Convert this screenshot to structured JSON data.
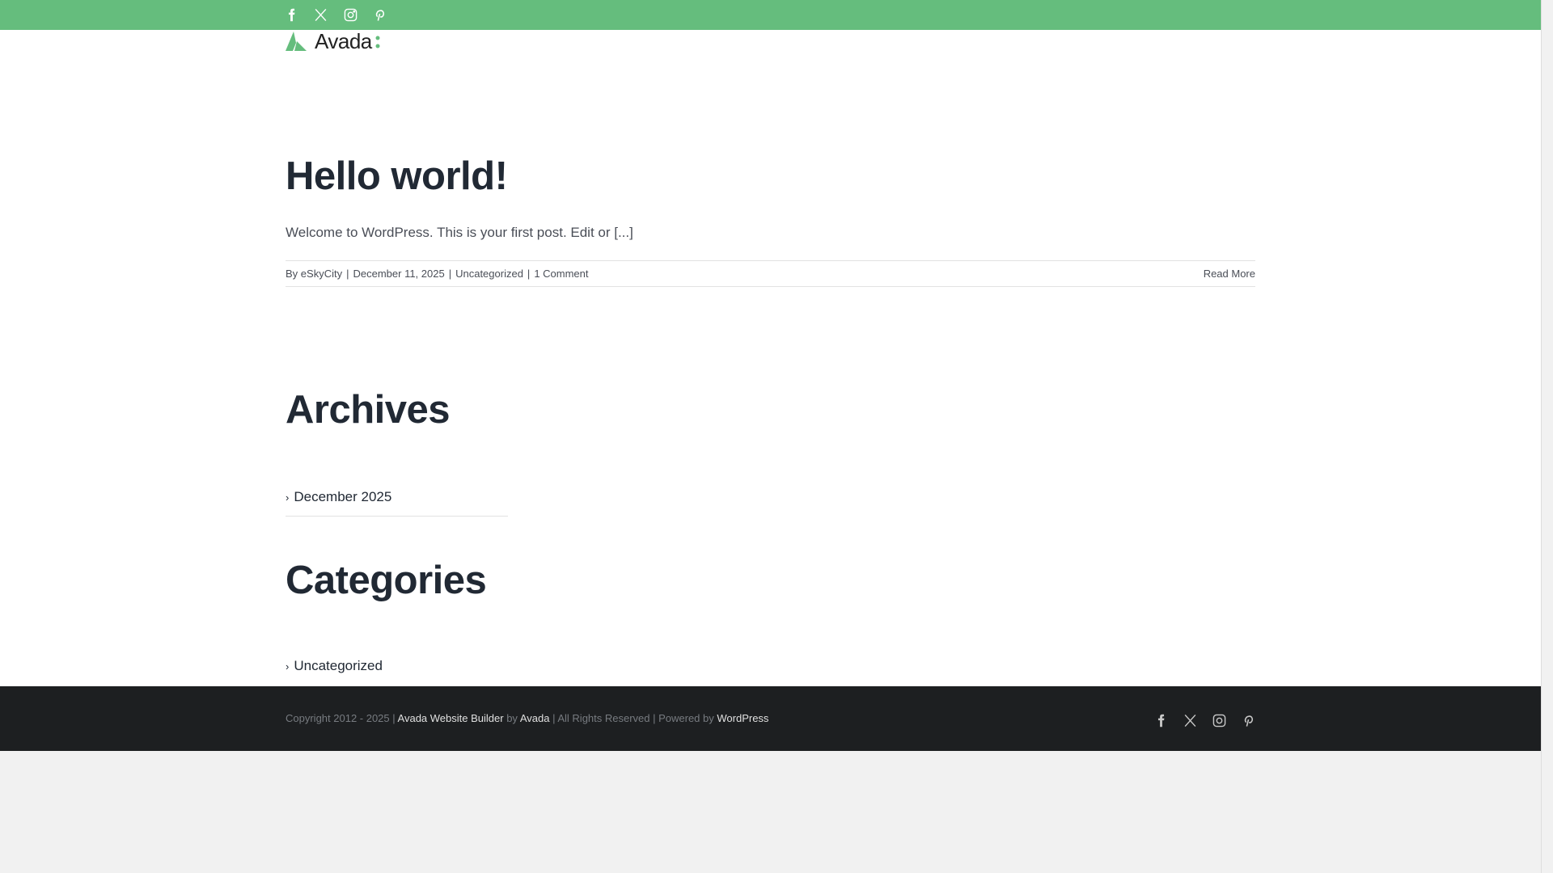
{
  "topbar": {
    "social": [
      "facebook",
      "x",
      "instagram",
      "pinterest"
    ]
  },
  "logo": {
    "text": "Avada"
  },
  "post": {
    "title": "Hello world!",
    "excerpt": "Welcome to WordPress. This is your first post. Edit or [...]",
    "by": "By",
    "author": "eSkyCity",
    "date": "December 11, 2025",
    "category": "Uncategorized",
    "comments": "1 Comment",
    "read_more": "Read More",
    "separator": "|"
  },
  "archives": {
    "title": "Archives",
    "items": [
      "December 2025"
    ]
  },
  "categories": {
    "title": "Categories",
    "items": [
      "Uncategorized"
    ]
  },
  "footer": {
    "copyright": "Copyright 2012 - 2025 | ",
    "builder": "Avada Website Builder",
    "by": " by ",
    "avada": "Avada",
    "rights": " | All Rights Reserved | Powered by ",
    "wordpress": "WordPress"
  },
  "colors": {
    "accent": "#65bd7d",
    "footer_bg": "#1d1f21"
  }
}
